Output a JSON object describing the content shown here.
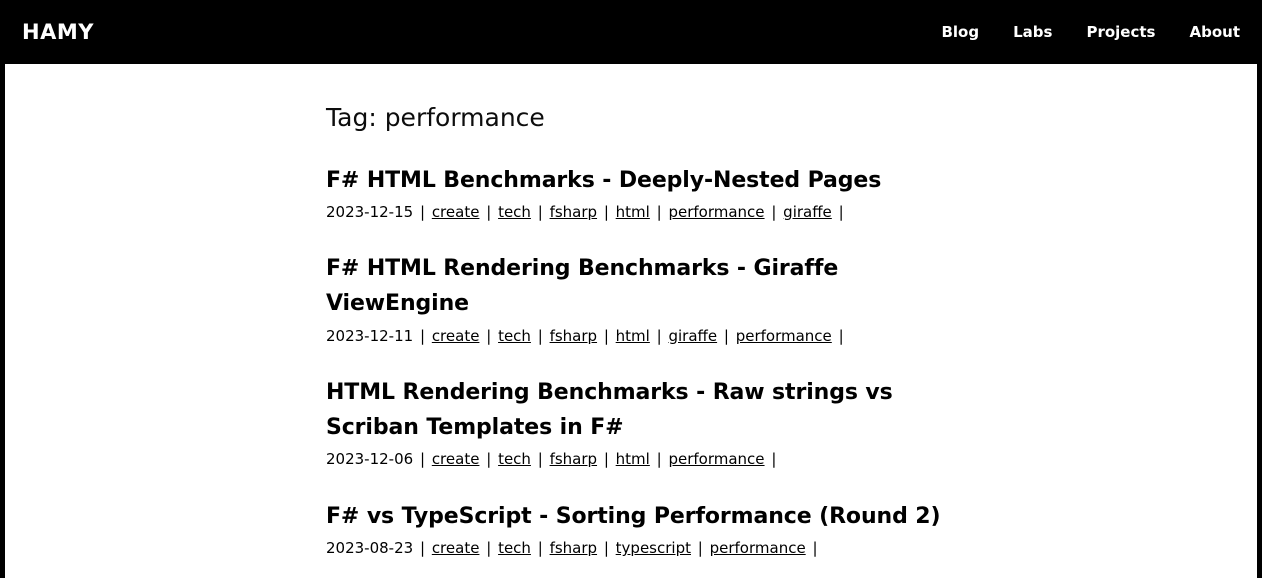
{
  "header": {
    "logo": "HAMY",
    "nav": [
      {
        "label": "Blog"
      },
      {
        "label": "Labs"
      },
      {
        "label": "Projects"
      },
      {
        "label": "About"
      }
    ]
  },
  "main": {
    "page_title": "Tag: performance",
    "separator": "|",
    "posts": [
      {
        "title": "F# HTML Benchmarks - Deeply-Nested Pages",
        "date": "2023-12-15",
        "tags": [
          "create",
          "tech",
          "fsharp",
          "html",
          "performance",
          "giraffe"
        ]
      },
      {
        "title": "F# HTML Rendering Benchmarks - Giraffe ViewEngine",
        "date": "2023-12-11",
        "tags": [
          "create",
          "tech",
          "fsharp",
          "html",
          "giraffe",
          "performance"
        ]
      },
      {
        "title": "HTML Rendering Benchmarks - Raw strings vs Scriban Templates in F#",
        "date": "2023-12-06",
        "tags": [
          "create",
          "tech",
          "fsharp",
          "html",
          "performance"
        ]
      },
      {
        "title": "F# vs TypeScript - Sorting Performance (Round 2)",
        "date": "2023-08-23",
        "tags": [
          "create",
          "tech",
          "fsharp",
          "typescript",
          "performance"
        ]
      }
    ]
  },
  "colors": {
    "header_bg": "#000000",
    "header_text": "#ffffff",
    "page_bg": "#ffffff",
    "body_text": "#000000",
    "border": "#000000"
  }
}
